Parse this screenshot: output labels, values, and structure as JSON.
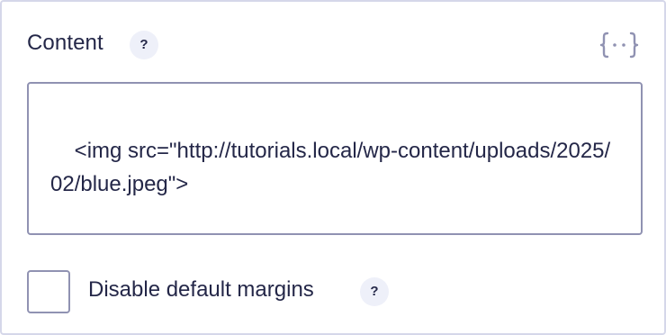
{
  "content_field": {
    "label": "Content",
    "help_icon_text": "?",
    "merge_tag_icon": "merge-tag-braces-icon",
    "value": "<img src=\"http://tutorials.local/wp-content/uploads/2025/02/blue.jpeg\">"
  },
  "margins_option": {
    "label": "Disable default margins",
    "help_icon_text": "?",
    "checked": false
  },
  "colors": {
    "text": "#242748",
    "border": "#9092b2",
    "panel_border": "#d5d7e9",
    "help_badge_bg": "#eef0f9"
  }
}
